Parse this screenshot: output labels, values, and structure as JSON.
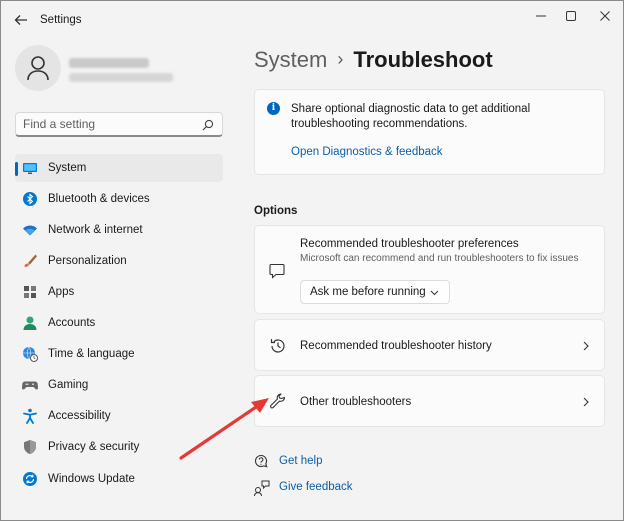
{
  "titlebar": {
    "title": "Settings",
    "back_icon": "arrow-left-icon",
    "controls": [
      "minimize-icon",
      "maximize-icon",
      "close-icon"
    ]
  },
  "profile": {
    "name_blurred": true,
    "email_blurred": true
  },
  "search": {
    "placeholder": "Find a setting",
    "value": ""
  },
  "sidebar": {
    "items": [
      {
        "label": "System",
        "icon": "monitor-icon",
        "active": true
      },
      {
        "label": "Bluetooth & devices",
        "icon": "bluetooth-icon",
        "active": false
      },
      {
        "label": "Network & internet",
        "icon": "wifi-icon",
        "active": false
      },
      {
        "label": "Personalization",
        "icon": "brush-icon",
        "active": false
      },
      {
        "label": "Apps",
        "icon": "apps-icon",
        "active": false
      },
      {
        "label": "Accounts",
        "icon": "person-icon",
        "active": false
      },
      {
        "label": "Time & language",
        "icon": "globe-clock-icon",
        "active": false
      },
      {
        "label": "Gaming",
        "icon": "gamepad-icon",
        "active": false
      },
      {
        "label": "Accessibility",
        "icon": "accessibility-icon",
        "active": false
      },
      {
        "label": "Privacy & security",
        "icon": "shield-icon",
        "active": false
      },
      {
        "label": "Windows Update",
        "icon": "update-icon",
        "active": false
      }
    ]
  },
  "main": {
    "breadcrumb": {
      "parent": "System",
      "separator": "›",
      "current": "Troubleshoot"
    },
    "info": {
      "text": "Share optional diagnostic data to get additional troubleshooting recommendations.",
      "link": "Open Diagnostics & feedback"
    },
    "options_title": "Options",
    "preferences": {
      "title": "Recommended troubleshooter preferences",
      "description": "Microsoft can recommend and run troubleshooters to fix issues",
      "selected": "Ask me before running"
    },
    "history": {
      "label": "Recommended troubleshooter history"
    },
    "other": {
      "label": "Other troubleshooters"
    },
    "help": {
      "get_help": "Get help",
      "give_feedback": "Give feedback"
    }
  },
  "colors": {
    "accent": "#0067c0",
    "link": "#0a5ea8",
    "annotation_arrow": "#e53935"
  }
}
